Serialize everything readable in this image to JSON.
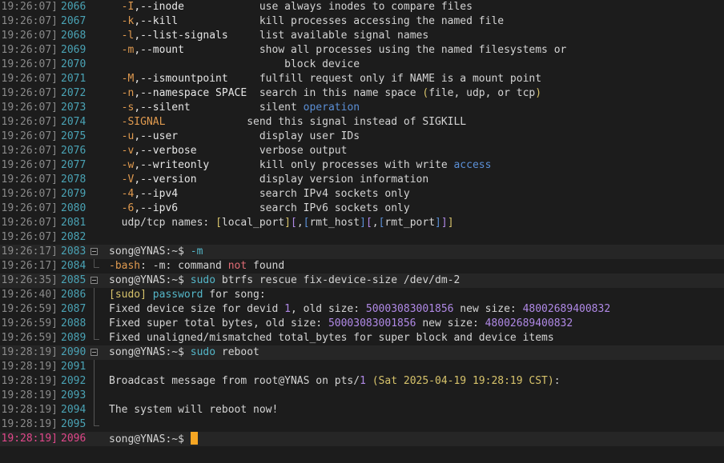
{
  "lines": [
    {
      "ts": "19:26:07]",
      "n": "2066",
      "seg": [
        [
          "",
          "  "
        ],
        [
          "o",
          "-I"
        ],
        [
          "w",
          ",--inode"
        ],
        [
          "",
          "            use always inodes to compare files"
        ]
      ]
    },
    {
      "ts": "19:26:07]",
      "n": "2067",
      "seg": [
        [
          "",
          "  "
        ],
        [
          "o",
          "-k"
        ],
        [
          "w",
          ",--kill"
        ],
        [
          "",
          "             kill processes accessing the named file"
        ]
      ]
    },
    {
      "ts": "19:26:07]",
      "n": "2068",
      "seg": [
        [
          "",
          "  "
        ],
        [
          "o",
          "-l"
        ],
        [
          "w",
          ",--list-signals"
        ],
        [
          "",
          "     list available signal names"
        ]
      ]
    },
    {
      "ts": "19:26:07]",
      "n": "2069",
      "seg": [
        [
          "",
          "  "
        ],
        [
          "o",
          "-m"
        ],
        [
          "w",
          ",--mount"
        ],
        [
          "",
          "            show all processes using the named filesystems or"
        ]
      ]
    },
    {
      "ts": "19:26:07]",
      "n": "2070",
      "seg": [
        [
          "",
          "                            block device"
        ]
      ]
    },
    {
      "ts": "19:26:07]",
      "n": "2071",
      "seg": [
        [
          "",
          "  "
        ],
        [
          "o",
          "-M"
        ],
        [
          "w",
          ",--ismountpoint"
        ],
        [
          "",
          "     fulfill request only if NAME is a mount point"
        ]
      ]
    },
    {
      "ts": "19:26:07]",
      "n": "2072",
      "seg": [
        [
          "",
          "  "
        ],
        [
          "o",
          "-n"
        ],
        [
          "w",
          ",--namespace SPACE"
        ],
        [
          "",
          "  search in this name space "
        ],
        [
          "y",
          "("
        ],
        [
          "",
          "file, udp, or tcp"
        ],
        [
          "y",
          ")"
        ]
      ]
    },
    {
      "ts": "19:26:07]",
      "n": "2073",
      "seg": [
        [
          "",
          "  "
        ],
        [
          "o",
          "-s"
        ],
        [
          "w",
          ",--silent"
        ],
        [
          "",
          "           silent "
        ],
        [
          "b",
          "operation"
        ]
      ]
    },
    {
      "ts": "19:26:07]",
      "n": "2074",
      "seg": [
        [
          "",
          "  "
        ],
        [
          "o",
          "-SIGNAL"
        ],
        [
          "",
          "             send this signal instead of SIGKILL"
        ]
      ]
    },
    {
      "ts": "19:26:07]",
      "n": "2075",
      "seg": [
        [
          "",
          "  "
        ],
        [
          "o",
          "-u"
        ],
        [
          "w",
          ",--user"
        ],
        [
          "",
          "             display user IDs"
        ]
      ]
    },
    {
      "ts": "19:26:07]",
      "n": "2076",
      "seg": [
        [
          "",
          "  "
        ],
        [
          "o",
          "-v"
        ],
        [
          "w",
          ",--verbose"
        ],
        [
          "",
          "          verbose output"
        ]
      ]
    },
    {
      "ts": "19:26:07]",
      "n": "2077",
      "seg": [
        [
          "",
          "  "
        ],
        [
          "o",
          "-w"
        ],
        [
          "w",
          ",--writeonly"
        ],
        [
          "",
          "        kill only processes with write "
        ],
        [
          "b",
          "access"
        ]
      ]
    },
    {
      "ts": "19:26:07]",
      "n": "2078",
      "seg": [
        [
          "",
          "  "
        ],
        [
          "o",
          "-V"
        ],
        [
          "w",
          ",--version"
        ],
        [
          "",
          "          display version information"
        ]
      ]
    },
    {
      "ts": "19:26:07]",
      "n": "2079",
      "seg": [
        [
          "",
          "  "
        ],
        [
          "o",
          "-4"
        ],
        [
          "w",
          ",--ipv4"
        ],
        [
          "",
          "             search IPv4 sockets only"
        ]
      ]
    },
    {
      "ts": "19:26:07]",
      "n": "2080",
      "seg": [
        [
          "",
          "  "
        ],
        [
          "o",
          "-6"
        ],
        [
          "w",
          ",--ipv6"
        ],
        [
          "",
          "             search IPv6 sockets only"
        ]
      ]
    },
    {
      "ts": "19:26:07]",
      "n": "2081",
      "seg": [
        [
          "",
          "  udp/tcp names: "
        ],
        [
          "y",
          "["
        ],
        [
          "",
          "local_port"
        ],
        [
          "y",
          "]"
        ],
        [
          "p",
          "["
        ],
        [
          "",
          ","
        ],
        [
          "b",
          "["
        ],
        [
          "",
          "rmt_host"
        ],
        [
          "b",
          "]"
        ],
        [
          "p",
          "["
        ],
        [
          "",
          ","
        ],
        [
          "b",
          "["
        ],
        [
          "",
          "rmt_port"
        ],
        [
          "b",
          "]"
        ],
        [
          "p",
          "]"
        ],
        [
          "y",
          "]"
        ]
      ]
    },
    {
      "ts": "19:26:07]",
      "n": "2082",
      "seg": []
    },
    {
      "ts": "19:26:17]",
      "n": "2083",
      "hl": true,
      "fold": "start",
      "seg": [
        [
          "",
          "song@YNAS:~$ "
        ],
        [
          "c",
          "-m"
        ]
      ]
    },
    {
      "ts": "19:26:17]",
      "n": "2084",
      "fold": "end",
      "seg": [
        [
          "o",
          "-bash"
        ],
        [
          "",
          ": -m: command "
        ],
        [
          "r",
          "not"
        ],
        [
          "",
          " found"
        ]
      ]
    },
    {
      "ts": "19:26:35]",
      "n": "2085",
      "hl": true,
      "fold": "start",
      "seg": [
        [
          "",
          "song@YNAS:~$ "
        ],
        [
          "c",
          "sudo"
        ],
        [
          "",
          " btrfs rescue fix-device-size /dev/dm-2"
        ]
      ]
    },
    {
      "ts": "19:26:40]",
      "n": "2086",
      "fold": "bar",
      "seg": [
        [
          "y",
          "[sudo]"
        ],
        [
          "",
          ""
        ],
        [
          "c",
          " password"
        ],
        [
          "",
          " for song:"
        ]
      ]
    },
    {
      "ts": "19:26:59]",
      "n": "2087",
      "fold": "bar",
      "seg": [
        [
          "",
          "Fixed device size for devid "
        ],
        [
          "p",
          "1"
        ],
        [
          "",
          ", old size: "
        ],
        [
          "p",
          "50003083001856"
        ],
        [
          "",
          " new size: "
        ],
        [
          "p",
          "48002689400832"
        ]
      ]
    },
    {
      "ts": "19:26:59]",
      "n": "2088",
      "fold": "bar",
      "seg": [
        [
          "",
          "Fixed super total bytes, old size: "
        ],
        [
          "p",
          "50003083001856"
        ],
        [
          "",
          " new size: "
        ],
        [
          "p",
          "48002689400832"
        ]
      ]
    },
    {
      "ts": "19:26:59]",
      "n": "2089",
      "fold": "end",
      "seg": [
        [
          "",
          "Fixed unaligned/mismatched total_bytes for super block and device items"
        ]
      ]
    },
    {
      "ts": "19:28:19]",
      "n": "2090",
      "hl": true,
      "fold": "start",
      "seg": [
        [
          "",
          "song@YNAS:~$ "
        ],
        [
          "c",
          "sudo"
        ],
        [
          "",
          " reboot"
        ]
      ]
    },
    {
      "ts": "19:28:19]",
      "n": "2091",
      "fold": "bar",
      "seg": []
    },
    {
      "ts": "19:28:19]",
      "n": "2092",
      "fold": "bar",
      "seg": [
        [
          "",
          "Broadcast message from root@YNAS on pts/"
        ],
        [
          "p",
          "1"
        ],
        [
          "",
          " "
        ],
        [
          "y",
          "(Sat 2025-04-19 19:28:19 CST)"
        ],
        [
          "",
          ":"
        ]
      ]
    },
    {
      "ts": "19:28:19]",
      "n": "2093",
      "fold": "bar",
      "seg": []
    },
    {
      "ts": "19:28:19]",
      "n": "2094",
      "fold": "bar",
      "seg": [
        [
          "",
          "The system will reboot now!"
        ]
      ]
    },
    {
      "ts": "19:28:19]",
      "n": "2095",
      "fold": "end",
      "seg": []
    },
    {
      "ts": "19:28:19]",
      "n": "2096",
      "hl": true,
      "cur": true,
      "seg": [
        [
          "",
          "song@YNAS:~$ "
        ]
      ]
    }
  ]
}
